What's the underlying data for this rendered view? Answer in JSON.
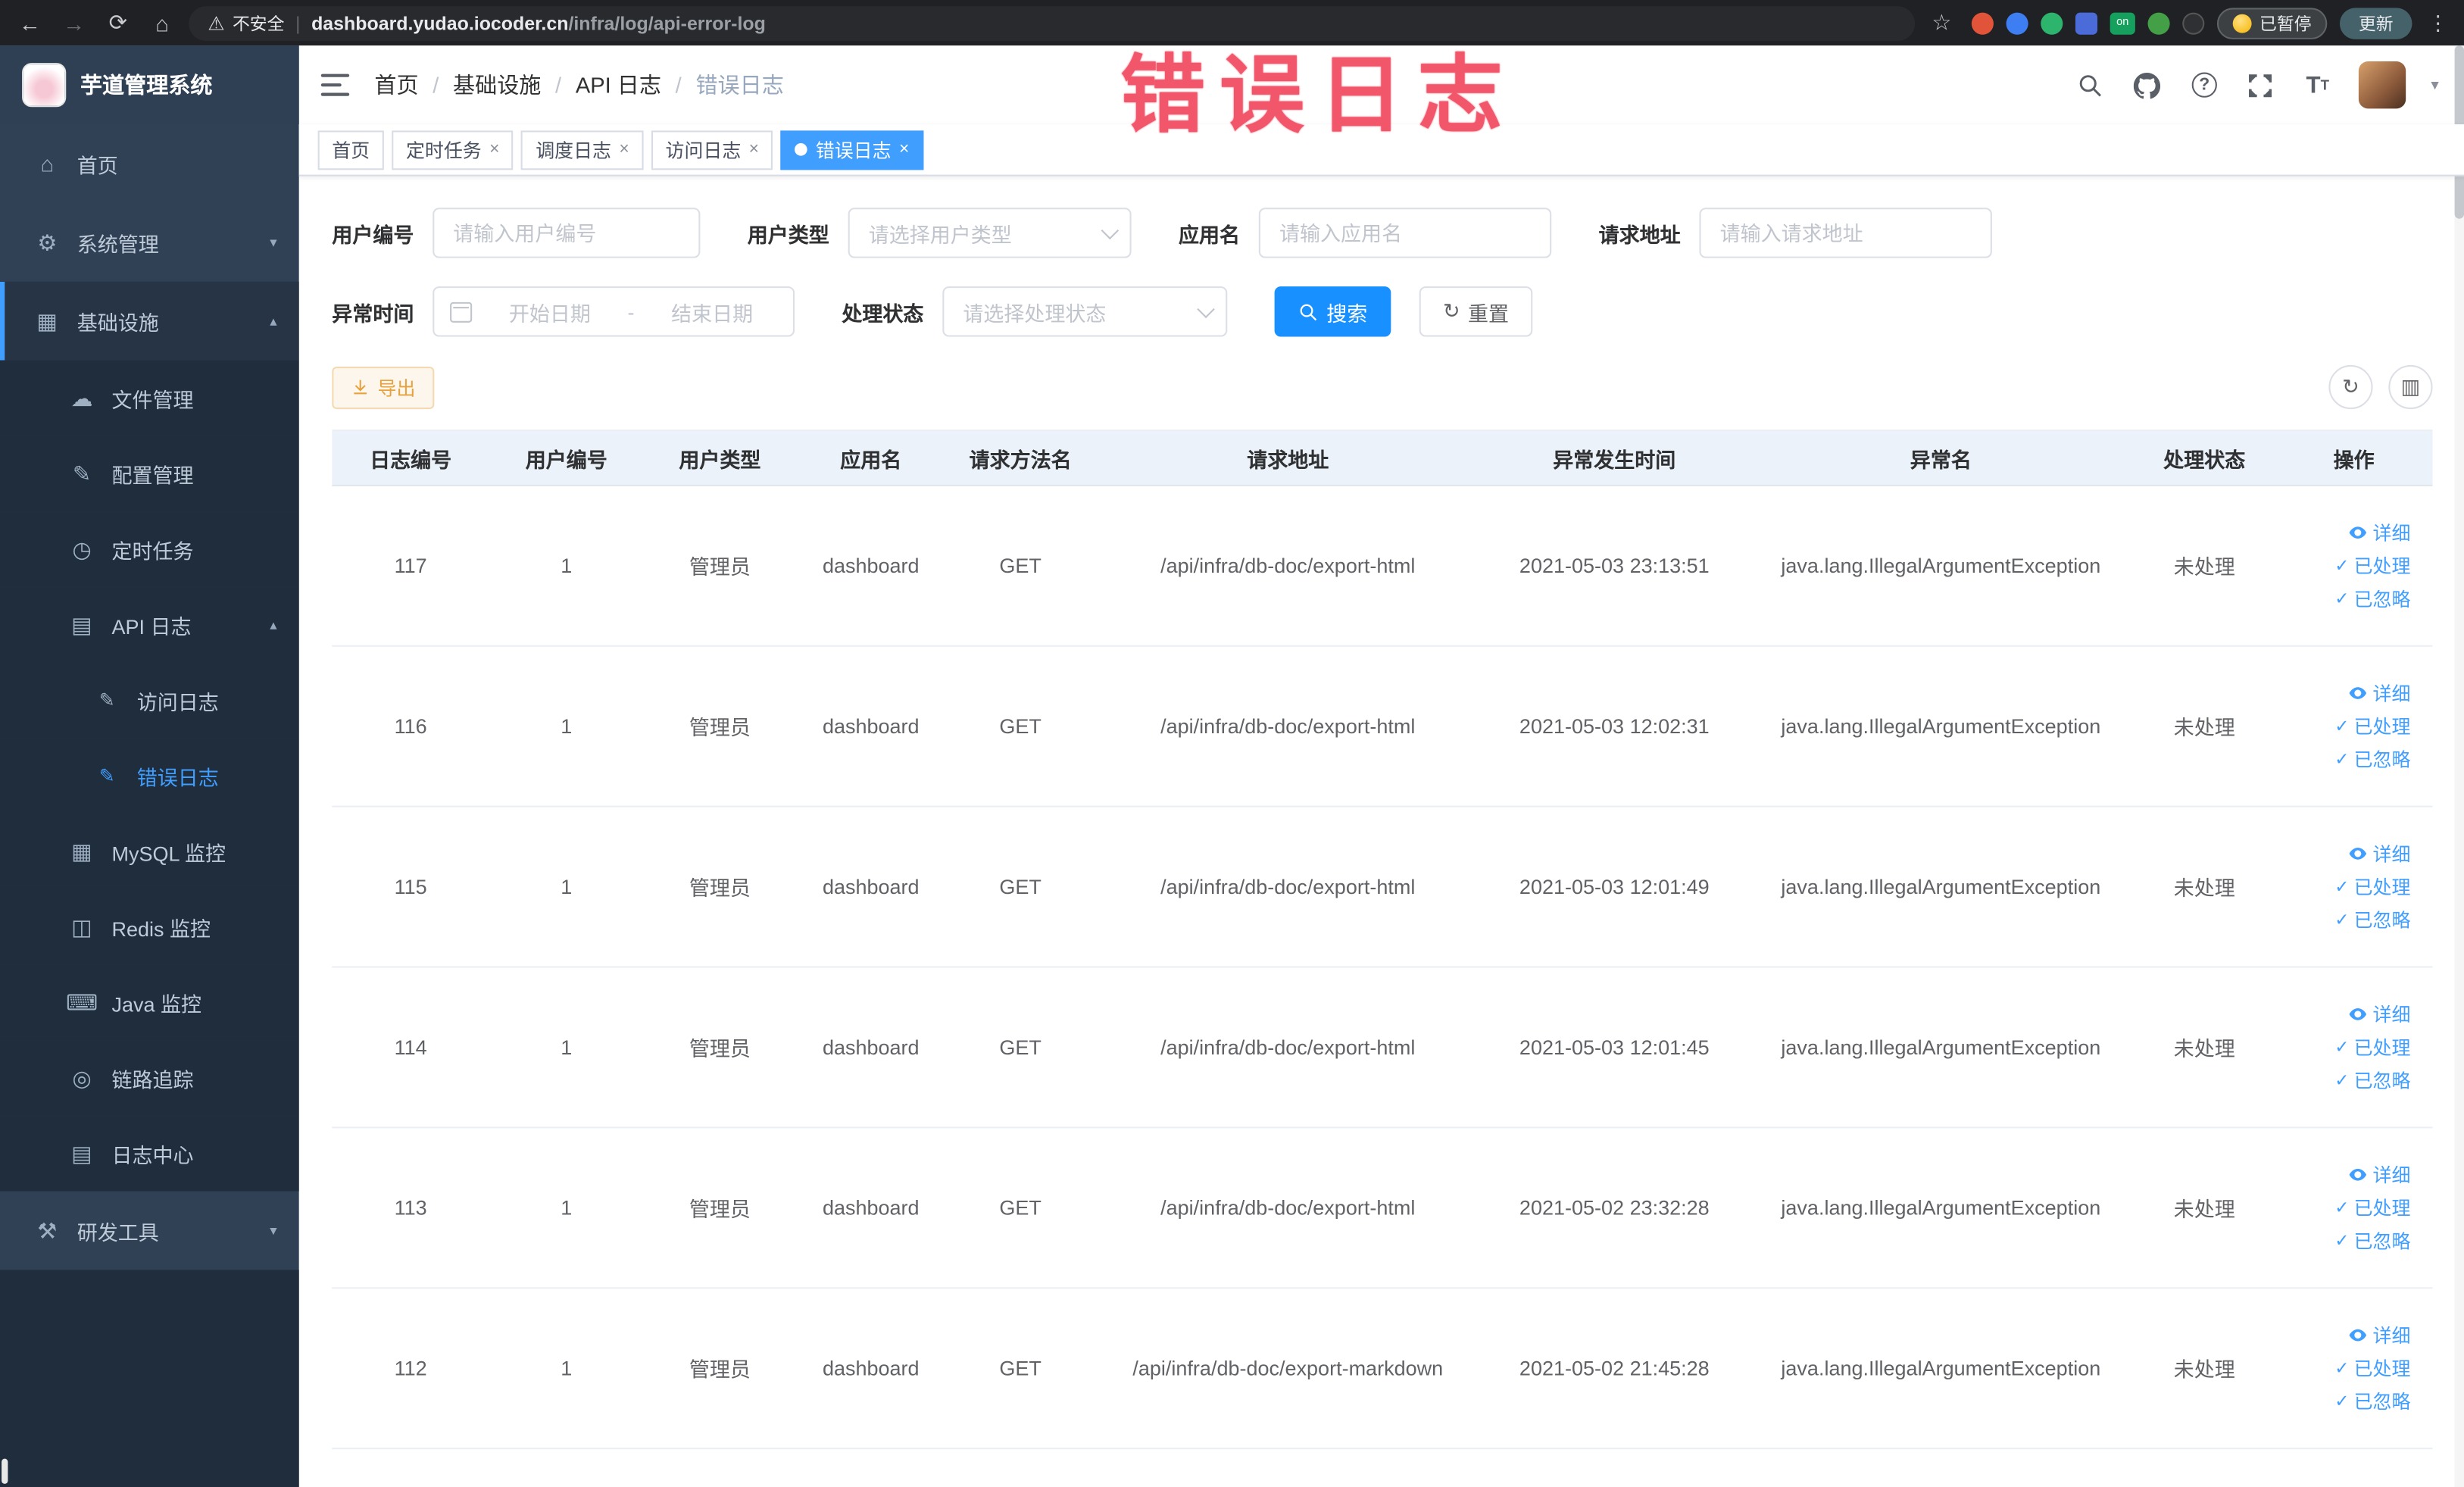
{
  "browser": {
    "security_label": "不安全",
    "url_domain": "dashboard.yudao.iocoder.cn",
    "url_path": "/infra/log/api-error-log",
    "paused_badge": "已暂停",
    "update_button": "更新"
  },
  "annotation": {
    "text": "错误日志",
    "color": "#f2566b"
  },
  "icons": {
    "back": "←",
    "forward": "→",
    "reload": "⟳",
    "browser_home": "⌂",
    "warning": "⚠",
    "star": "☆",
    "menu_dots": "⋮",
    "pipe": "|",
    "home": "⌂",
    "gear": "⚙",
    "monitor": "▦",
    "cloud": "☁",
    "pencil": "✎",
    "clock": "◷",
    "doc": "▤",
    "db": "◫",
    "keyboard": "⌨",
    "eye": "◎",
    "tools": "⚒",
    "chevron_down": "▾",
    "chevron_up": "▴",
    "caret_down": "▾",
    "check": "✓",
    "close": "×",
    "refresh": "↻",
    "columns": "▥"
  },
  "sidebar": {
    "logo_title": "芋道管理系统",
    "home": "首页",
    "system_mgmt": "系统管理",
    "infrastructure": "基础设施",
    "file_mgmt": "文件管理",
    "config_mgmt": "配置管理",
    "scheduled_jobs": "定时任务",
    "api_logs": "API 日志",
    "access_log": "访问日志",
    "error_log": "错误日志",
    "mysql_monitor": "MySQL 监控",
    "redis_monitor": "Redis 监控",
    "java_monitor": "Java 监控",
    "trace": "链路追踪",
    "log_center": "日志中心",
    "dev_tools": "研发工具"
  },
  "breadcrumb": {
    "separator": "/",
    "items": [
      "首页",
      "基础设施",
      "API 日志",
      "错误日志"
    ]
  },
  "tabs": [
    {
      "label": "首页"
    },
    {
      "label": "定时任务"
    },
    {
      "label": "调度日志"
    },
    {
      "label": "访问日志"
    },
    {
      "label": "错误日志"
    }
  ],
  "filters": {
    "user_id": {
      "label": "用户编号",
      "placeholder": "请输入用户编号"
    },
    "user_type": {
      "label": "用户类型",
      "placeholder": "请选择用户类型"
    },
    "app_name": {
      "label": "应用名",
      "placeholder": "请输入应用名"
    },
    "request_url": {
      "label": "请求地址",
      "placeholder": "请输入请求地址"
    },
    "exception_time": {
      "label": "异常时间",
      "start_placeholder": "开始日期",
      "separator": "-",
      "end_placeholder": "结束日期"
    },
    "process_status": {
      "label": "处理状态",
      "placeholder": "请选择处理状态"
    },
    "search_button": "搜索",
    "reset_button": "重置"
  },
  "toolbar": {
    "export_button": "导出"
  },
  "table": {
    "columns": [
      "日志编号",
      "用户编号",
      "用户类型",
      "应用名",
      "请求方法名",
      "请求地址",
      "异常发生时间",
      "异常名",
      "处理状态",
      "操作"
    ],
    "row_actions": {
      "detail": "详细",
      "processed": "已处理",
      "ignored": "已忽略"
    },
    "rows": [
      {
        "log_id": "117",
        "user_id": "1",
        "user_type": "管理员",
        "app_name": "dashboard",
        "method": "GET",
        "request_url": "/api/infra/db-doc/export-html",
        "time": "2021-05-03 23:13:51",
        "exception": "java.lang.IllegalArgumentException",
        "status": "未处理"
      },
      {
        "log_id": "116",
        "user_id": "1",
        "user_type": "管理员",
        "app_name": "dashboard",
        "method": "GET",
        "request_url": "/api/infra/db-doc/export-html",
        "time": "2021-05-03 12:02:31",
        "exception": "java.lang.IllegalArgumentException",
        "status": "未处理"
      },
      {
        "log_id": "115",
        "user_id": "1",
        "user_type": "管理员",
        "app_name": "dashboard",
        "method": "GET",
        "request_url": "/api/infra/db-doc/export-html",
        "time": "2021-05-03 12:01:49",
        "exception": "java.lang.IllegalArgumentException",
        "status": "未处理"
      },
      {
        "log_id": "114",
        "user_id": "1",
        "user_type": "管理员",
        "app_name": "dashboard",
        "method": "GET",
        "request_url": "/api/infra/db-doc/export-html",
        "time": "2021-05-03 12:01:45",
        "exception": "java.lang.IllegalArgumentException",
        "status": "未处理"
      },
      {
        "log_id": "113",
        "user_id": "1",
        "user_type": "管理员",
        "app_name": "dashboard",
        "method": "GET",
        "request_url": "/api/infra/db-doc/export-html",
        "time": "2021-05-02 23:32:28",
        "exception": "java.lang.IllegalArgumentException",
        "status": "未处理"
      },
      {
        "log_id": "112",
        "user_id": "1",
        "user_type": "管理员",
        "app_name": "dashboard",
        "method": "GET",
        "request_url": "/api/infra/db-doc/export-markdown",
        "time": "2021-05-02 21:45:28",
        "exception": "java.lang.IllegalArgumentException",
        "status": "未处理"
      }
    ]
  },
  "colors": {
    "primary": "#409eff",
    "search_button": "#1890ff",
    "warning": "#e6a23c",
    "sidebar_bg": "#304156",
    "submenu_bg": "#1f2d3d",
    "table_header_bg": "#ebf2fa"
  }
}
